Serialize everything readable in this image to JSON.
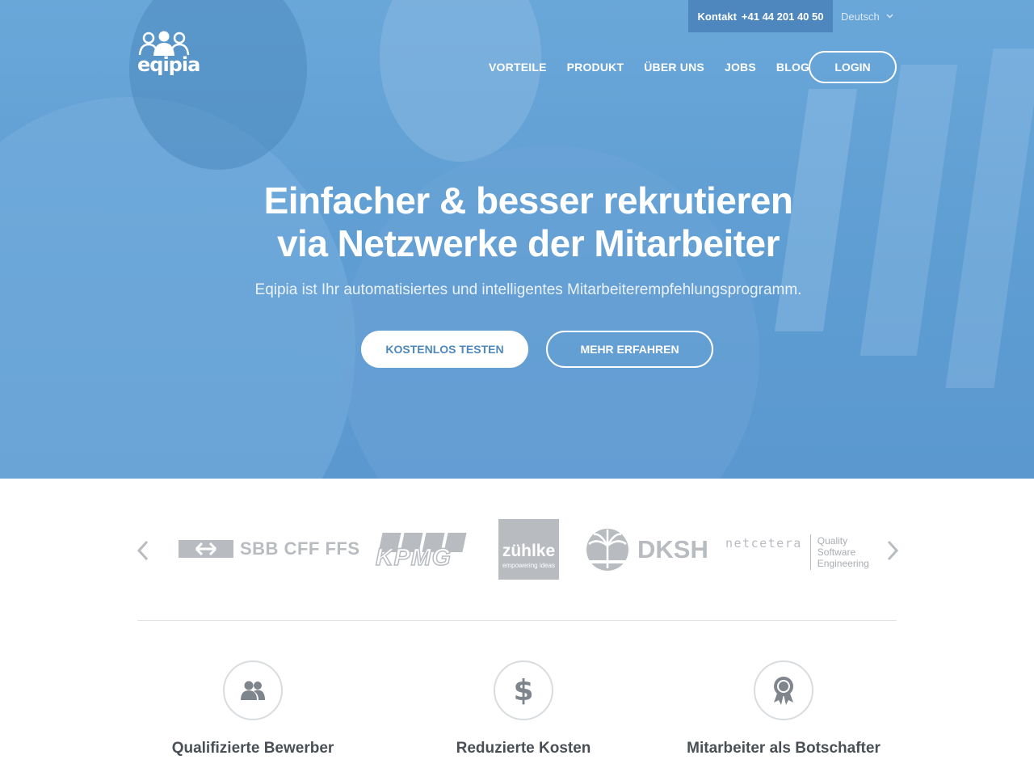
{
  "topbar": {
    "contact_label": "Kontakt",
    "phone": "+41 44 201 40 50",
    "language": "Deutsch"
  },
  "brand": {
    "logo_text": "eqipia"
  },
  "nav": {
    "items": [
      "VORTEILE",
      "PRODUKT",
      "ÜBER UNS",
      "JOBS",
      "BLOG"
    ],
    "login_label": "LOGIN"
  },
  "hero": {
    "headline_line1": "Einfacher & besser rekrutieren",
    "headline_line2": "via Netzwerke der Mitarbeiter",
    "subline": "Eqipia ist Ihr automatisiertes und intelligentes Mitarbeiterempfehlungsprogramm.",
    "cta_primary": "KOSTENLOS TESTEN",
    "cta_secondary": "MEHR ERFAHREN"
  },
  "clients": {
    "logos": [
      {
        "name": "SBB CFF FFS",
        "text": "SBB CFF FFS"
      },
      {
        "name": "KPMG",
        "text": "KPMG"
      },
      {
        "name": "zühlke",
        "text": "zühlke",
        "tagline": "empowering ideas"
      },
      {
        "name": "DKSH",
        "text": "DKSH"
      },
      {
        "name": "netcetera",
        "text": "netcetera",
        "tagline_lines": [
          "Quality",
          "Software",
          "Engineering"
        ]
      }
    ]
  },
  "features": [
    {
      "title": "Qualifizierte Bewerber",
      "icon": "people-icon"
    },
    {
      "title": "Reduzierte Kosten",
      "icon": "dollar-icon"
    },
    {
      "title": "Mitarbeiter als Botschafter",
      "icon": "award-ribbon-icon"
    }
  ],
  "colors": {
    "hero_blue": "#5e9dd2",
    "contact_blue": "#4d87bd",
    "logo_gray": "#b8bcc1",
    "text_dark": "#4a4f55"
  }
}
